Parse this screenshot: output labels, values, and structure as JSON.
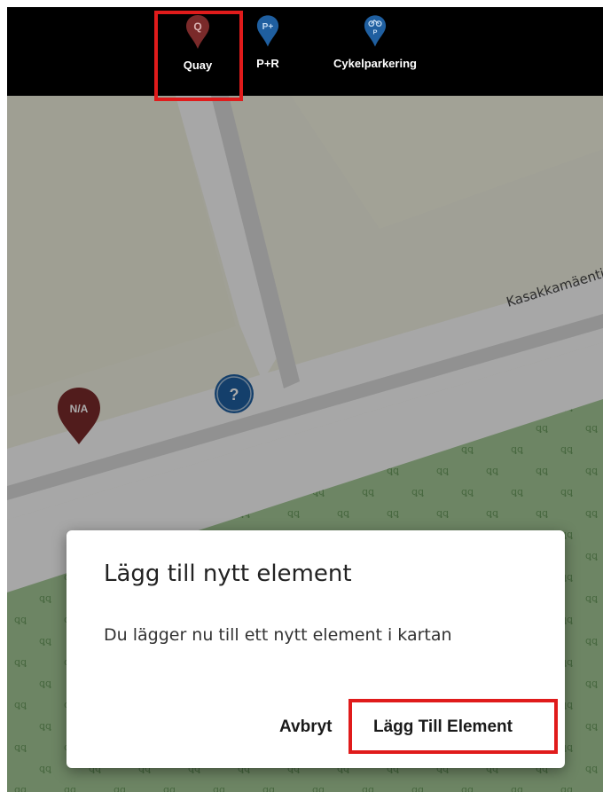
{
  "toolbar": {
    "items": [
      {
        "label": "Quay",
        "icon": "quay-pin-icon",
        "icon_text": "Q",
        "color": "#7a2a2a",
        "highlighted": true
      },
      {
        "label": "P+R",
        "icon": "park-and-ride-pin-icon",
        "icon_text": "P+",
        "color": "#1f5fa0"
      },
      {
        "label": "Cykelparkering",
        "icon": "bicycle-parking-pin-icon",
        "icon_text": "P",
        "color": "#1f5fa0"
      }
    ]
  },
  "map": {
    "street_label": "Kasakkamäentie",
    "markers": [
      {
        "label": "N/A",
        "icon": "na-marker-pin-icon",
        "color": "#7a2a2a"
      },
      {
        "label": "?",
        "icon": "unknown-stop-marker-icon",
        "color": "#1f5fa0"
      }
    ],
    "colors": {
      "land": "#efefe0",
      "road": "#fafafa",
      "path": "#d8d8d8",
      "forest": "#a3c796",
      "tree": "#6a9a5e"
    }
  },
  "dialog": {
    "title": "Lägg till nytt element",
    "body": "Du lägger nu till ett nytt element i kartan",
    "cancel_label": "Avbryt",
    "confirm_label": "Lägg Till Element",
    "highlight_color": "#e01b1b"
  }
}
